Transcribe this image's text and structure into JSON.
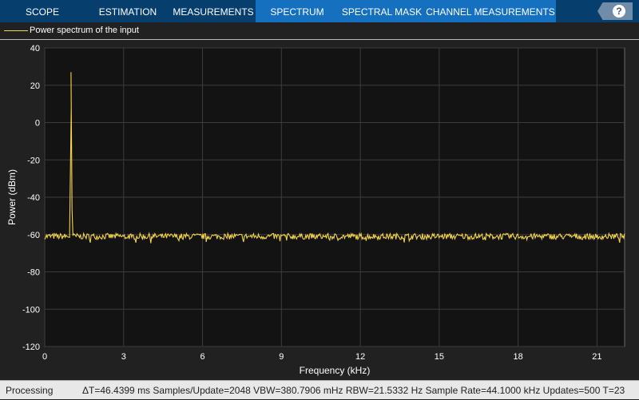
{
  "tabs": [
    {
      "label": "SCOPE",
      "selected": false
    },
    {
      "label": "ESTIMATION",
      "selected": false
    },
    {
      "label": "MEASUREMENTS",
      "selected": false
    },
    {
      "label": "SPECTRUM",
      "selected": true
    },
    {
      "label": "SPECTRAL MASK",
      "selected": true
    },
    {
      "label": "CHANNEL MEASUREMENTS",
      "selected": true
    }
  ],
  "help_icon": "question-mark-icon",
  "status": {
    "state": "Processing",
    "info": "ΔT=46.4399 ms  Samples/Update=2048  VBW=380.7906 mHz  RBW=21.5332 Hz  Sample Rate=44.1000 kHz  Updates=500  T=23"
  },
  "chart_data": {
    "type": "line",
    "xlabel": "Frequency (kHz)",
    "ylabel": "Power (dBm)",
    "xlim": [
      0,
      22.05
    ],
    "ylim": [
      -120,
      40
    ],
    "xticks": [
      "0",
      "3",
      "6",
      "9",
      "12",
      "15",
      "18",
      "21"
    ],
    "yticks": [
      "40",
      "20",
      "0",
      "-20",
      "-40",
      "-60",
      "-80",
      "-100",
      "-120"
    ],
    "grid": true,
    "legend_position": "top-left",
    "series": [
      {
        "name": "Power spectrum of the input",
        "color": "#f5d54a",
        "x": [
          0,
          0.95,
          0.98,
          1.0,
          1.02,
          1.05,
          22.05
        ],
        "y": [
          -61,
          -61,
          -20,
          27,
          -20,
          -61,
          -61
        ]
      }
    ],
    "noise_floor_dbm": -61
  }
}
